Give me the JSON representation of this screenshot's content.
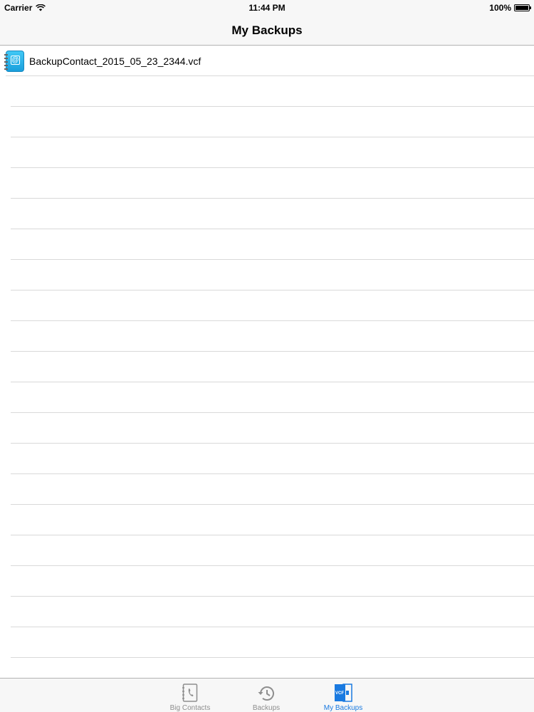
{
  "status_bar": {
    "carrier": "Carrier",
    "time": "11:44 PM",
    "battery": "100%"
  },
  "nav": {
    "title": "My Backups"
  },
  "files": [
    {
      "name": "BackupContact_2015_05_23_2344.vcf",
      "icon": "vcf-contact-icon"
    }
  ],
  "tabs": [
    {
      "label": "Big Contacts",
      "icon": "contacts-book-icon",
      "active": false
    },
    {
      "label": "Backups",
      "icon": "history-icon",
      "active": false
    },
    {
      "label": "My Backups",
      "icon": "vcf-file-icon",
      "active": true
    }
  ],
  "colors": {
    "accent": "#1a7ae0",
    "inactive": "#8e8e8e",
    "icon_blue": "#1a9fdc"
  }
}
